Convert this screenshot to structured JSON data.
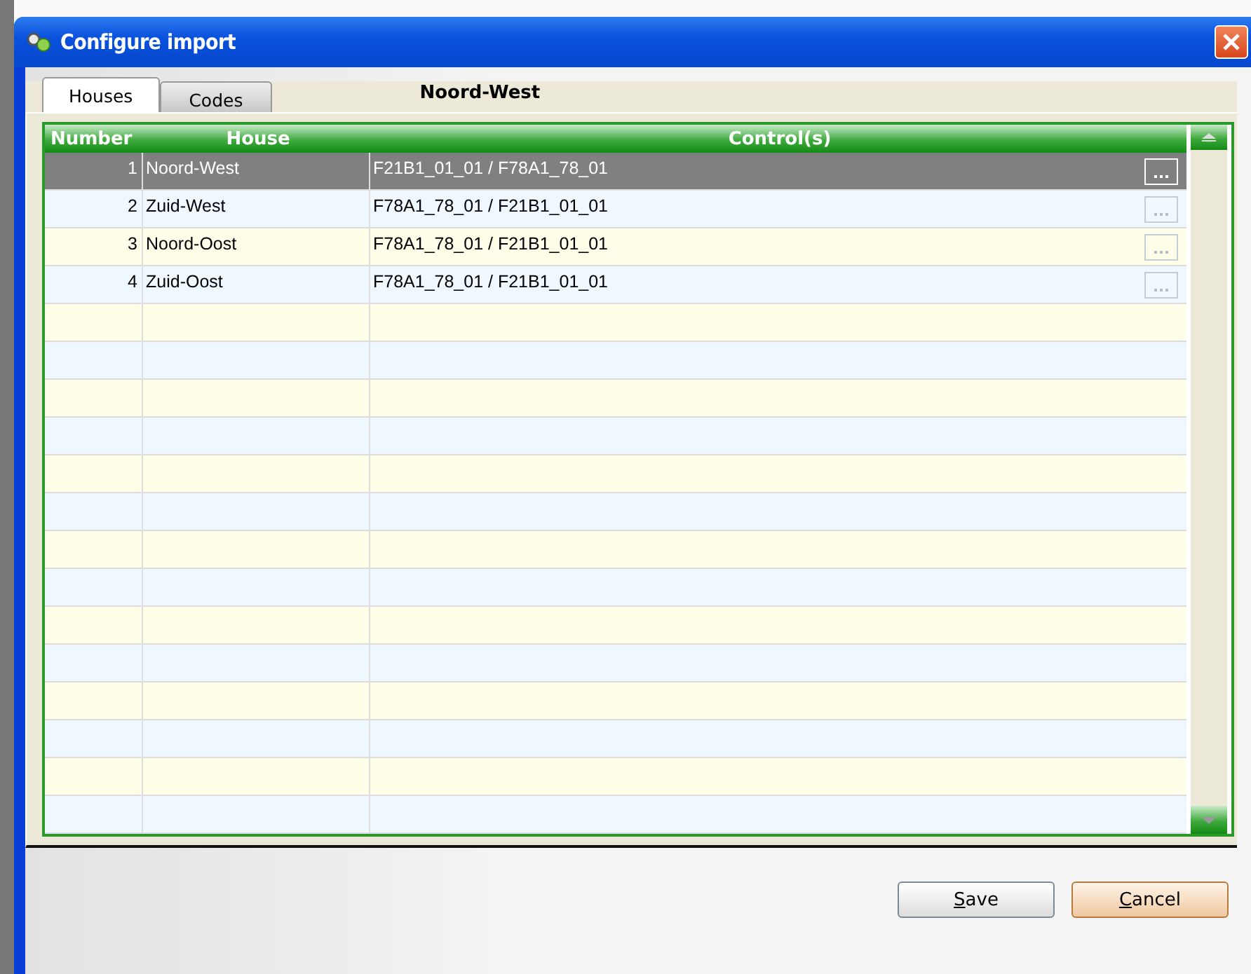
{
  "window": {
    "title": "Configure import"
  },
  "tabs": [
    {
      "label": "Houses",
      "selected": true
    },
    {
      "label": "Codes",
      "selected": false
    }
  ],
  "current_house": "Noord-West",
  "table": {
    "columns": [
      "Number",
      "House",
      "Control(s)"
    ],
    "rows": [
      {
        "number": "1",
        "house": "Noord-West",
        "controls": "F21B1_01_01 / F78A1_78_01",
        "selected": true
      },
      {
        "number": "2",
        "house": "Zuid-West",
        "controls": "F78A1_78_01 / F21B1_01_01",
        "selected": false
      },
      {
        "number": "3",
        "house": "Noord-Oost",
        "controls": "F78A1_78_01 / F21B1_01_01",
        "selected": false
      },
      {
        "number": "4",
        "house": "Zuid-Oost",
        "controls": "F78A1_78_01 / F21B1_01_01",
        "selected": false
      }
    ]
  },
  "buttons": [
    {
      "label": "Save",
      "kind": "default"
    },
    {
      "label": "Cancel",
      "kind": "cancel"
    }
  ]
}
